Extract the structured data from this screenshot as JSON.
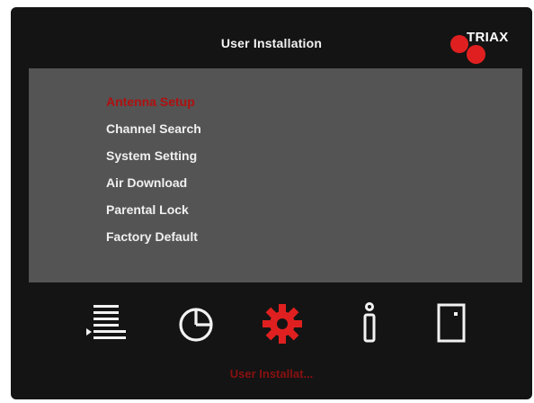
{
  "screen": {
    "title": "User Installation",
    "brand": "TRIAX",
    "accent_color": "#e02020",
    "selected_color": "#b01010"
  },
  "menu": {
    "items": [
      {
        "label": "Antenna Setup",
        "selected": true
      },
      {
        "label": "Channel Search",
        "selected": false
      },
      {
        "label": "System Setting",
        "selected": false
      },
      {
        "label": "Air Download",
        "selected": false
      },
      {
        "label": "Parental Lock",
        "selected": false
      },
      {
        "label": "Factory Default",
        "selected": false
      }
    ]
  },
  "bottom_bar": {
    "icons": [
      {
        "name": "list-icon",
        "active": false
      },
      {
        "name": "pie-chart-icon",
        "active": false
      },
      {
        "name": "gear-icon",
        "active": true
      },
      {
        "name": "info-icon",
        "active": false
      },
      {
        "name": "door-icon",
        "active": false
      }
    ],
    "active_label": "User Installat..."
  }
}
